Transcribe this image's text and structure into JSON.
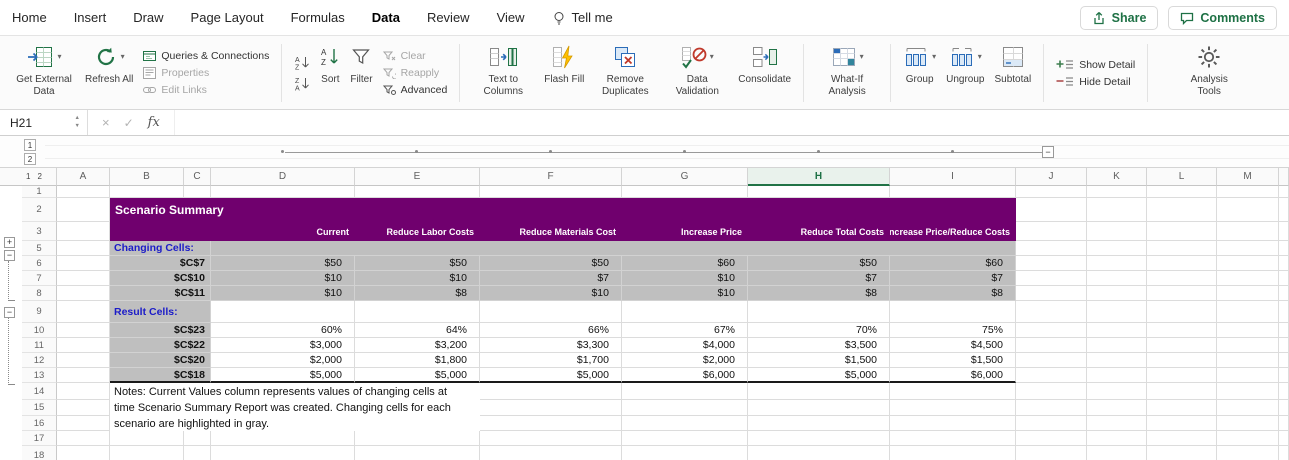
{
  "icons": {
    "chevron_down": "▾",
    "plus": "+",
    "minus": "−",
    "up": "▲",
    "down": "▼",
    "cancel": "×",
    "check": "✓"
  },
  "menu": {
    "tabs": [
      "Home",
      "Insert",
      "Draw",
      "Page Layout",
      "Formulas",
      "Data",
      "Review",
      "View"
    ],
    "active_tab": "Data",
    "tell_me": "Tell me",
    "share": "Share",
    "comments": "Comments"
  },
  "ribbon": {
    "get_external_data": "Get External Data",
    "refresh_all": "Refresh All",
    "queries_connections": "Queries & Connections",
    "properties": "Properties",
    "edit_links": "Edit Links",
    "sort": "Sort",
    "filter": "Filter",
    "clear": "Clear",
    "reapply": "Reapply",
    "advanced": "Advanced",
    "text_to_columns": "Text to Columns",
    "flash_fill": "Flash Fill",
    "remove_duplicates": "Remove Duplicates",
    "data_validation": "Data Validation",
    "consolidate": "Consolidate",
    "what_if": "What-If Analysis",
    "group": "Group",
    "ungroup": "Ungroup",
    "subtotal": "Subtotal",
    "show_detail": "Show Detail",
    "hide_detail": "Hide Detail",
    "analysis_tools": "Analysis Tools"
  },
  "formula_bar": {
    "name_box": "H21",
    "fx_label": "fx",
    "formula": ""
  },
  "outline": {
    "levels": [
      "1",
      "2"
    ]
  },
  "sheet": {
    "columns": [
      "A",
      "B",
      "C",
      "D",
      "E",
      "F",
      "G",
      "H",
      "I",
      "J",
      "K",
      "L",
      "M"
    ],
    "selected_column": "H",
    "row_numbers": [
      "1",
      "2",
      "3",
      "5",
      "6",
      "7",
      "8",
      "9",
      "10",
      "11",
      "12",
      "13",
      "14",
      "15",
      "16",
      "17",
      "18"
    ],
    "title": "Scenario Summary",
    "headers": [
      "Current",
      "Reduce Labor Costs",
      "Reduce Materials Cost",
      "Increase Price",
      "Reduce Total Costs",
      "Increase Price/Reduce Costs"
    ],
    "changing_label": "Changing Cells:",
    "result_label": "Result Cells:",
    "changing_rows": [
      {
        "ref": "$C$7",
        "values": [
          "$50",
          "$50",
          "$50",
          "$60",
          "$50",
          "$60"
        ]
      },
      {
        "ref": "$C$10",
        "values": [
          "$10",
          "$10",
          "$7",
          "$10",
          "$7",
          "$7"
        ]
      },
      {
        "ref": "$C$11",
        "values": [
          "$10",
          "$8",
          "$10",
          "$10",
          "$8",
          "$8"
        ]
      }
    ],
    "result_rows": [
      {
        "ref": "$C$23",
        "values": [
          "60%",
          "64%",
          "66%",
          "67%",
          "70%",
          "75%"
        ]
      },
      {
        "ref": "$C$22",
        "values": [
          "$3,000",
          "$3,200",
          "$3,300",
          "$4,000",
          "$3,500",
          "$4,500"
        ]
      },
      {
        "ref": "$C$20",
        "values": [
          "$2,000",
          "$1,800",
          "$1,700",
          "$2,000",
          "$1,500",
          "$1,500"
        ]
      },
      {
        "ref": "$C$18",
        "values": [
          "$5,000",
          "$5,000",
          "$5,000",
          "$6,000",
          "$5,000",
          "$6,000"
        ]
      }
    ],
    "notes": [
      "Notes:  Current Values column represents values of changing cells at",
      "time Scenario Summary Report was created.  Changing cells for each",
      "scenario are highlighted in gray."
    ]
  }
}
